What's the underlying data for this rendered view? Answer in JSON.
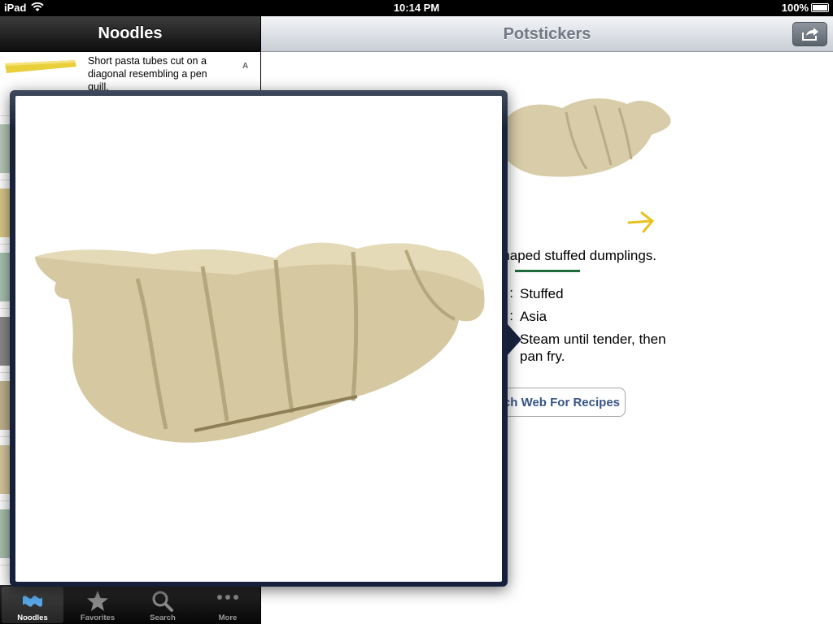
{
  "status_bar": {
    "carrier": "iPad",
    "time": "10:14 PM",
    "battery": "100%"
  },
  "master": {
    "title": "Noodles",
    "rows": [
      {
        "description": "Short pasta tubes cut on a diagonal resembling a pen quill.",
        "index_letter": "A"
      }
    ]
  },
  "tabs": [
    {
      "label": "Noodles",
      "icon": "noodle-icon",
      "selected": true
    },
    {
      "label": "Favorites",
      "icon": "star-icon",
      "selected": false
    },
    {
      "label": "Search",
      "icon": "magnifier-icon",
      "selected": false
    },
    {
      "label": "More",
      "icon": "more-dots-icon",
      "selected": false
    }
  ],
  "detail": {
    "title": "Potstickers",
    "description_visible": "haped stuffed dumplings.",
    "properties": [
      {
        "key_visible": ":",
        "value": "Stuffed"
      },
      {
        "key_visible": ":",
        "value": "Asia"
      },
      {
        "key_visible": ":",
        "value": "Steam until tender, then pan fry."
      }
    ],
    "search_button_visible": "ch Web For Recipes"
  },
  "colors": {
    "accent_green": "#1f6b3c",
    "link_blue": "#385487",
    "arrow_yellow": "#e8c21e",
    "popover_frame": "#16203a"
  }
}
